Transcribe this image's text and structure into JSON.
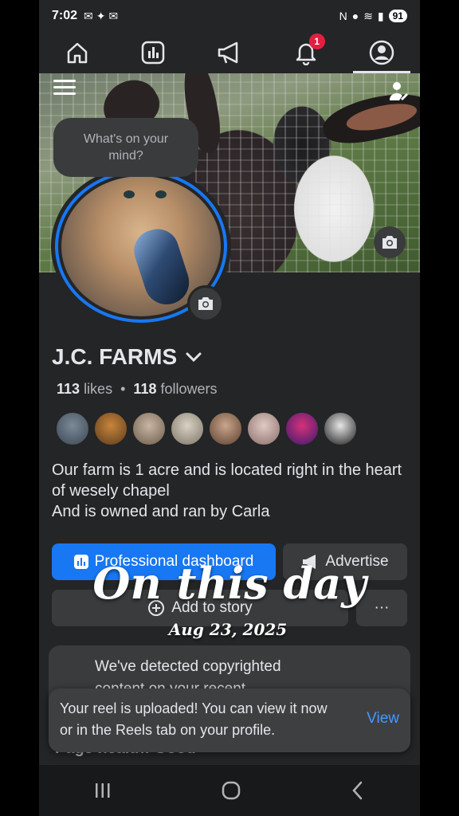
{
  "status_bar": {
    "time": "7:02",
    "battery": "91"
  },
  "nav": {
    "notification_count": "1"
  },
  "cover": {
    "composer_prompt": "What's on your mind?"
  },
  "page": {
    "name": "J.C. FARMS",
    "likes_count": "113",
    "likes_label": "likes",
    "followers_count": "118",
    "followers_label": "followers",
    "bio_line1": "Our farm is 1 acre and is located right in the heart of wesely chapel",
    "bio_line2": "And is owned and ran by Carla"
  },
  "actions": {
    "professional_dashboard": "Professional dashboard",
    "advertise": "Advertise",
    "add_to_story": "Add to story",
    "more": "···"
  },
  "overlay": {
    "title": "On this day",
    "date": "Aug 23, 2025"
  },
  "toasts": {
    "copyright_line1": "We've detected copyrighted",
    "copyright_line2": "content on your recent",
    "reel_message": "Your reel is uploaded! You can view it now or in the Reels tab on your profile.",
    "view_label": "View"
  },
  "behind_text": "Page health: Good",
  "colors": {
    "accent": "#1877f2",
    "background": "#242526",
    "surface": "#3a3b3c",
    "badge": "#e41e3f",
    "link": "#4599ff"
  },
  "icons": [
    "home-icon",
    "insights-icon",
    "megaphone-icon",
    "bell-icon",
    "profile-icon",
    "camera-icon",
    "chevron-down-icon",
    "plus-circle-icon"
  ]
}
